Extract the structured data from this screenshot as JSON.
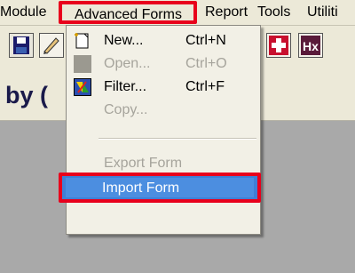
{
  "menubar": {
    "items": [
      {
        "label": "Module"
      },
      {
        "label": "Advanced Forms"
      },
      {
        "label": "Report"
      },
      {
        "label": "Tools"
      },
      {
        "label": "Utiliti"
      }
    ]
  },
  "title": {
    "text": "by ("
  },
  "menu": {
    "items": [
      {
        "label": "New...",
        "shortcut": "Ctrl+N",
        "enabled": true,
        "icon": "new-document-icon"
      },
      {
        "label": "Open...",
        "shortcut": "Ctrl+O",
        "enabled": false,
        "icon": "open-icon"
      },
      {
        "label": "Filter...",
        "shortcut": "Ctrl+F",
        "enabled": true,
        "icon": "filter-icon"
      },
      {
        "label": "Copy...",
        "shortcut": "",
        "enabled": false
      },
      {
        "label": "Export Form",
        "shortcut": "",
        "enabled": false
      },
      {
        "label": "Import Form",
        "shortcut": "",
        "enabled": true,
        "selected": true
      }
    ]
  },
  "colors": {
    "highlight_border": "#e8001c",
    "selection": "#4c8ee0",
    "menu_bg": "#f2f0e6",
    "app_bg": "#a9a9a9"
  }
}
